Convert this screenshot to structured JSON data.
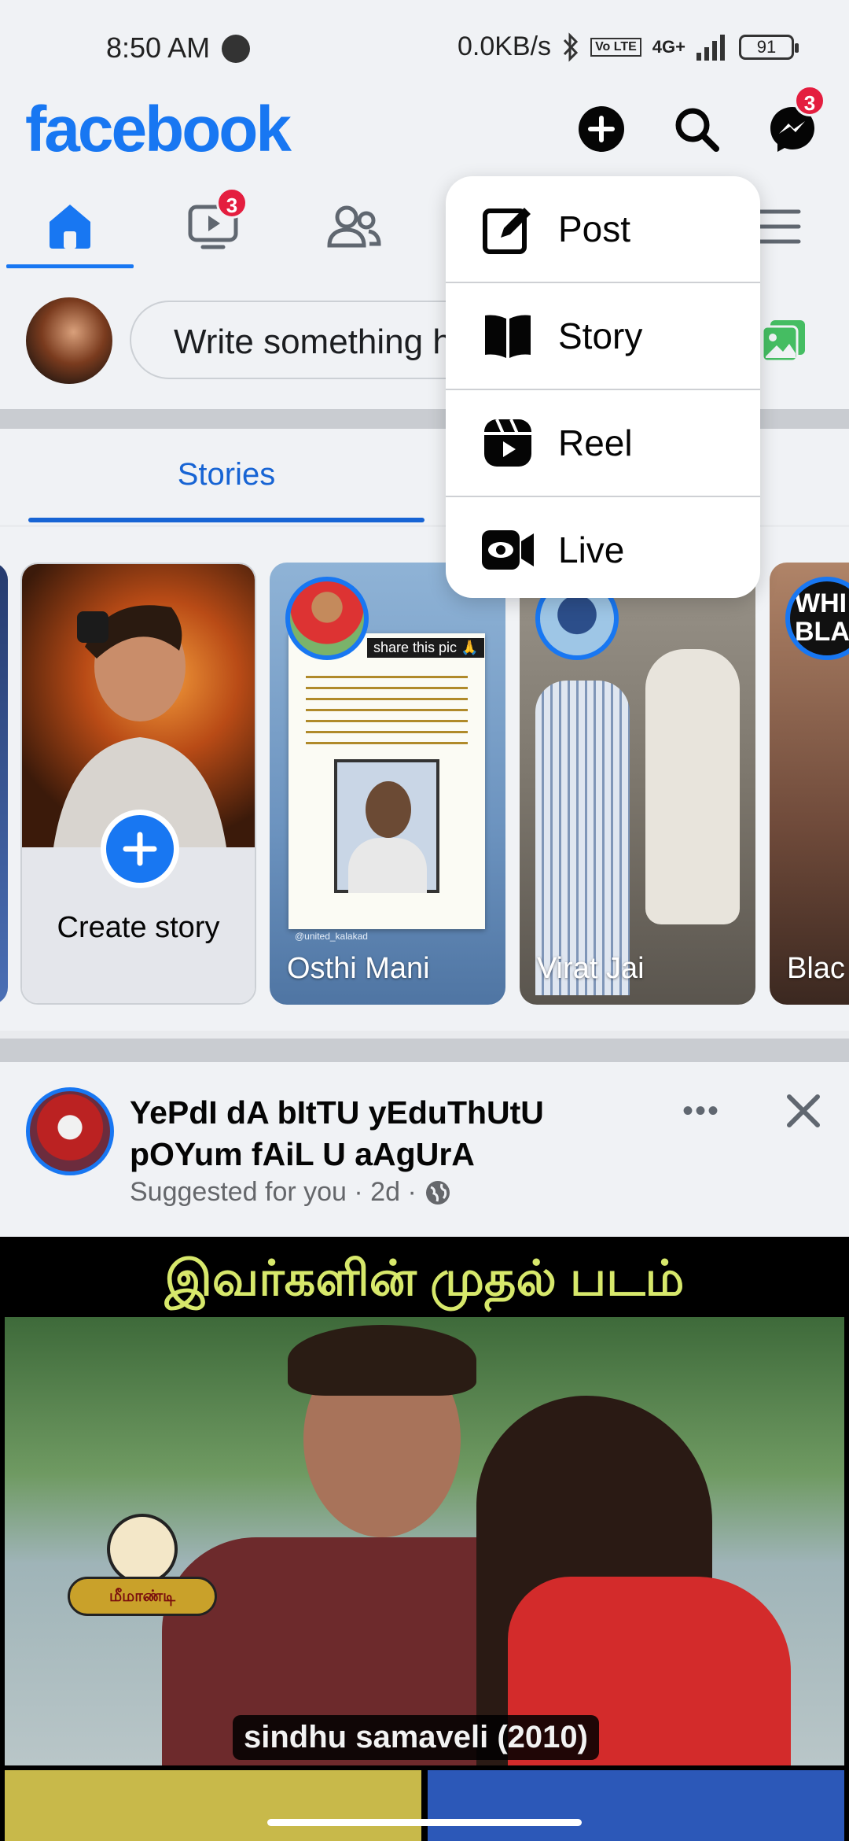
{
  "status_bar": {
    "time": "8:50 AM",
    "network_speed": "0.0KB/s",
    "volte": "Vo LTE",
    "signal": "4G+",
    "battery": "91"
  },
  "header": {
    "logo": "facebook",
    "messenger_badge": "3"
  },
  "tabs": {
    "video_badge": "3"
  },
  "composer": {
    "placeholder": "Write something h"
  },
  "stories_section": {
    "tab_label": "Stories"
  },
  "stories": [
    {
      "label": "Create story"
    },
    {
      "name": "Osthi Mani",
      "overlay_text": "share this pic 🙏",
      "watermark": "@united_kalakad"
    },
    {
      "name": "Virat Jai"
    },
    {
      "name": "Blac",
      "ring_text": "WHI BLAC"
    }
  ],
  "post": {
    "author": "YePdI dA bItTU yEduThUtU pOYum fAiL U aAgUrA",
    "meta": "Suggested for you · 2d ·",
    "image_title": "இவர்களின் முதல் படம்",
    "caption": "sindhu samaveli (2010)",
    "logo_text": "மீமாண்டி"
  },
  "create_menu": {
    "items": [
      {
        "label": "Post",
        "icon": "edit-icon"
      },
      {
        "label": "Story",
        "icon": "book-icon"
      },
      {
        "label": "Reel",
        "icon": "reel-icon"
      },
      {
        "label": "Live",
        "icon": "live-icon"
      }
    ]
  },
  "colors": {
    "brand": "#1877f2",
    "badge": "#e41e3f",
    "photo_icon": "#45bd62"
  }
}
